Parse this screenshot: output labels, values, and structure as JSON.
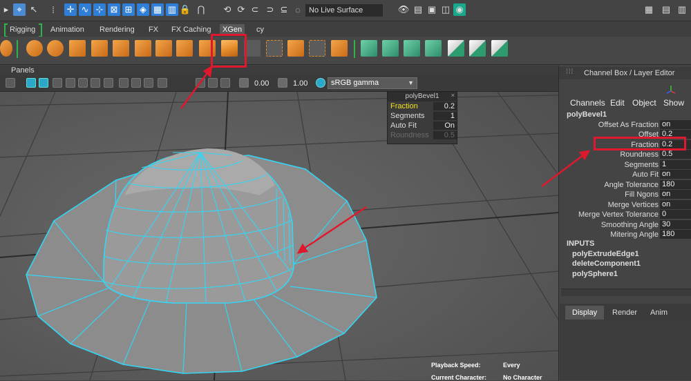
{
  "status_line": {
    "live_surface": "No Live Surface"
  },
  "shelf_tabs": [
    {
      "label": "Rigging",
      "active": false
    },
    {
      "label": "Animation",
      "active": false
    },
    {
      "label": "Rendering",
      "active": false
    },
    {
      "label": "FX",
      "active": false
    },
    {
      "label": "FX Caching",
      "active": false
    },
    {
      "label": "XGen",
      "active": true
    },
    {
      "label": "cy",
      "active": false
    }
  ],
  "viewport": {
    "panels_menu": "Panels",
    "exposure_value": "0.00",
    "gamma_value": "1.00",
    "color_space": "sRGB gamma"
  },
  "bevel_box": {
    "title": "polyBevel1",
    "rows": [
      {
        "label": "Fraction",
        "value": "0.2"
      },
      {
        "label": "Segments",
        "value": "1"
      },
      {
        "label": "Auto Fit",
        "value": "On"
      },
      {
        "label": "Roundness",
        "value": "0.5"
      }
    ]
  },
  "channel_box": {
    "title": "Channel Box / Layer Editor",
    "menu": [
      "Channels",
      "Edit",
      "Object",
      "Show"
    ],
    "node": "polyBevel1",
    "attributes": [
      {
        "name": "Offset As Fraction",
        "value": "on"
      },
      {
        "name": "Offset",
        "value": "0.2"
      },
      {
        "name": "Fraction",
        "value": "0.2"
      },
      {
        "name": "Roundness",
        "value": "0.5"
      },
      {
        "name": "Segments",
        "value": "1"
      },
      {
        "name": "Auto Fit",
        "value": "on"
      },
      {
        "name": "Angle Tolerance",
        "value": "180"
      },
      {
        "name": "Fill Ngons",
        "value": "on"
      },
      {
        "name": "Merge Vertices",
        "value": "on"
      },
      {
        "name": "Merge Vertex Tolerance",
        "value": "0"
      },
      {
        "name": "Smoothing Angle",
        "value": "30"
      },
      {
        "name": "Mitering Angle",
        "value": "180"
      }
    ],
    "inputs_title": "INPUTS",
    "inputs": [
      "polyExtrudeEdge1",
      "deleteComponent1",
      "polySphere1"
    ]
  },
  "layer_tabs": [
    "Display",
    "Render",
    "Anim"
  ],
  "info": {
    "playback_label": "Playback Speed:",
    "playback_value": "Every",
    "character_label": "Current Character:",
    "character_value": "No Character"
  },
  "colors": {
    "highlight": "#e0182d",
    "wireframe": "#33d6f5",
    "active_attr": "#f4e21a"
  }
}
